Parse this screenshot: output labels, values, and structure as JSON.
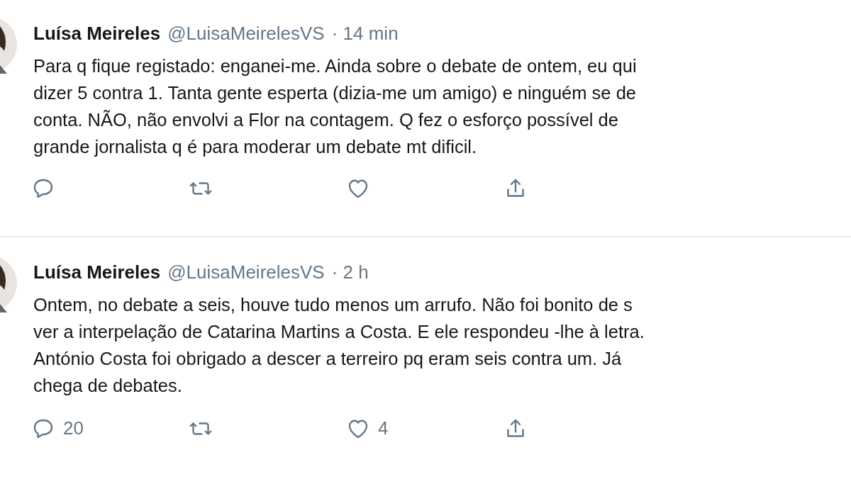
{
  "tweets": [
    {
      "name": "Luísa Meireles",
      "handle": "@LuisaMeirelesVS",
      "time": "· 14 min",
      "lines": [
        "Para q fique registado: enganei-me. Ainda sobre o debate de ontem, eu qui",
        "dizer 5 contra 1. Tanta gente esperta (dizia-me um amigo) e ninguém se de",
        "conta. NÃO, não envolvi a Flor na contagem. Q fez o esforço possível de",
        "grande jornalista q é para moderar um debate mt dificil."
      ],
      "actions": [
        {
          "kind": "reply"
        },
        {
          "kind": "retweet"
        },
        {
          "kind": "like"
        },
        {
          "kind": "share"
        }
      ]
    },
    {
      "name": "Luísa Meireles",
      "handle": "@LuisaMeirelesVS",
      "time": "· 2 h",
      "lines": [
        "Ontem, no debate a seis, houve tudo menos um arrufo. Não foi bonito de s",
        "ver a interpelação de Catarina Martins a Costa.  E ele respondeu -lhe à letra.",
        "António Costa foi obrigado a descer a terreiro pq eram seis contra um. Já",
        "chega de debates."
      ],
      "actions": [
        {
          "kind": "reply",
          "count": "20"
        },
        {
          "kind": "retweet"
        },
        {
          "kind": "like",
          "count": "4"
        },
        {
          "kind": "share"
        }
      ]
    }
  ]
}
